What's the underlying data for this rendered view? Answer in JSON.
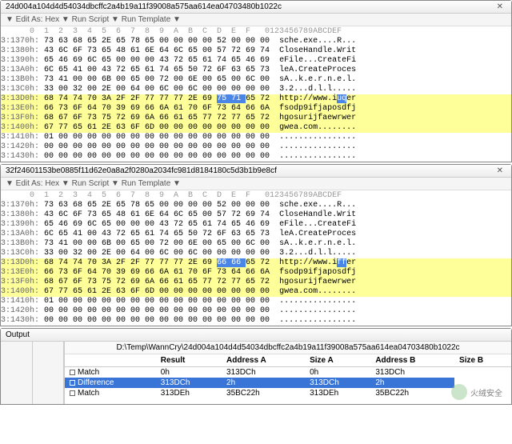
{
  "panel1": {
    "title": "24d004a104d4d54034dbcffc2a4b19a11f39008a575aa614ea04703480b1022c",
    "toolbar": "▼ Edit As: Hex ▼  Run Script ▼  Run Template ▼",
    "header": "      0  1  2  3  4  5  6  7  8  9  A  B  C  D  E  F   0123456789ABCDEF",
    "rows": [
      {
        "addr": "3:1370h:",
        "hex": " 73 63 68 65 2E 65 78 65 00 00 00 00 52 00 00 00 ",
        "ascii": " sche.exe....R..."
      },
      {
        "addr": "3:1380h:",
        "hex": " 43 6C 6F 73 65 48 61 6E 64 6C 65 00 57 72 69 74 ",
        "ascii": " CloseHandle.Writ"
      },
      {
        "addr": "3:1390h:",
        "hex": " 65 46 69 6C 65 00 00 00 43 72 65 61 74 65 46 69 ",
        "ascii": " eFile...CreateFi"
      },
      {
        "addr": "3:13A0h:",
        "hex": " 6C 65 41 00 43 72 65 61 74 65 50 72 6F 63 65 73 ",
        "ascii": " leA.CreateProces"
      },
      {
        "addr": "3:13B0h:",
        "hex": " 73 41 00 00 6B 00 65 00 72 00 6E 00 65 00 6C 00 ",
        "ascii": " sA..k.e.r.n.e.l."
      },
      {
        "addr": "3:13C0h:",
        "hex": " 33 00 32 00 2E 00 64 00 6C 00 6C 00 00 00 00 00 ",
        "ascii": " 3.2...d.l.l....."
      },
      {
        "addr": "3:13D0h:",
        "hex": " 68 74 74 70 3A 2F 2F 77 77 77 2E 69 ",
        "ascii": " http://www.i",
        "hl": true,
        "blue_hex": "75 71 ",
        "blue_ascii": "uq",
        "tail_hex": "65 72 ",
        "tail_ascii": "er"
      },
      {
        "addr": "3:13E0h:",
        "hex": " 66 73 6F 64 70 39 69 66 6A 61 70 6F 73 64 66 6A ",
        "ascii": " fsodp9ifjaposdfj",
        "hl": true
      },
      {
        "addr": "3:13F0h:",
        "hex": " 68 67 6F 73 75 72 69 6A 66 61 65 77 72 77 65 72 ",
        "ascii": " hgosurijfaewrwer",
        "hl": true
      },
      {
        "addr": "3:1400h:",
        "hex": " 67 77 65 61 2E 63 6F 6D 00 00 00 00 00 00 00 00 ",
        "ascii": " gwea.com........",
        "hl": true
      },
      {
        "addr": "3:1410h:",
        "hex": " 01 00 00 00 00 00 00 00 00 00 00 00 00 00 00 00 ",
        "ascii": " ................"
      },
      {
        "addr": "3:1420h:",
        "hex": " 00 00 00 00 00 00 00 00 00 00 00 00 00 00 00 00 ",
        "ascii": " ................"
      },
      {
        "addr": "3:1430h:",
        "hex": " 00 00 00 00 00 00 00 00 00 00 00 00 00 00 00 00 ",
        "ascii": " ................"
      }
    ]
  },
  "panel2": {
    "title": "32f24601153be0885f11d62e0a8a2f0280a2034fc981d8184180c5d3b1b9e8cf",
    "toolbar": "▼ Edit As: Hex ▼  Run Script ▼  Run Template ▼",
    "header": "      0  1  2  3  4  5  6  7  8  9  A  B  C  D  E  F   0123456789ABCDEF",
    "rows": [
      {
        "addr": "3:1370h:",
        "hex": " 73 63 68 65 2E 65 78 65 00 00 00 00 52 00 00 00 ",
        "ascii": " sche.exe....R..."
      },
      {
        "addr": "3:1380h:",
        "hex": " 43 6C 6F 73 65 48 61 6E 64 6C 65 00 57 72 69 74 ",
        "ascii": " CloseHandle.Writ"
      },
      {
        "addr": "3:1390h:",
        "hex": " 65 46 69 6C 65 00 00 00 43 72 65 61 74 65 46 69 ",
        "ascii": " eFile...CreateFi"
      },
      {
        "addr": "3:13A0h:",
        "hex": " 6C 65 41 00 43 72 65 61 74 65 50 72 6F 63 65 73 ",
        "ascii": " leA.CreateProces"
      },
      {
        "addr": "3:13B0h:",
        "hex": " 73 41 00 00 6B 00 65 00 72 00 6E 00 65 00 6C 00 ",
        "ascii": " sA..k.e.r.n.e.l."
      },
      {
        "addr": "3:13C0h:",
        "hex": " 33 00 32 00 2E 00 64 00 6C 00 6C 00 00 00 00 00 ",
        "ascii": " 3.2...d.l.l....."
      },
      {
        "addr": "3:13D0h:",
        "hex": " 68 74 74 70 3A 2F 2F 77 77 77 2E 69 ",
        "ascii": " http://www.i",
        "hl": true,
        "blue_hex": "66 66 ",
        "blue_ascii": "ff",
        "tail_hex": "65 72 ",
        "tail_ascii": "er"
      },
      {
        "addr": "3:13E0h:",
        "hex": " 66 73 6F 64 70 39 69 66 6A 61 70 6F 73 64 66 6A ",
        "ascii": " fsodp9ifjaposdfj",
        "hl": true
      },
      {
        "addr": "3:13F0h:",
        "hex": " 68 67 6F 73 75 72 69 6A 66 61 65 77 72 77 65 72 ",
        "ascii": " hgosurijfaewrwer",
        "hl": true
      },
      {
        "addr": "3:1400h:",
        "hex": " 67 77 65 61 2E 63 6F 6D 00 00 00 00 00 00 00 00 ",
        "ascii": " gwea.com........",
        "hl": true
      },
      {
        "addr": "3:1410h:",
        "hex": " 01 00 00 00 00 00 00 00 00 00 00 00 00 00 00 00 ",
        "ascii": " ................"
      },
      {
        "addr": "3:1420h:",
        "hex": " 00 00 00 00 00 00 00 00 00 00 00 00 00 00 00 00 ",
        "ascii": " ................"
      },
      {
        "addr": "3:1430h:",
        "hex": " 00 00 00 00 00 00 00 00 00 00 00 00 00 00 00 00 ",
        "ascii": " ................"
      }
    ]
  },
  "output": {
    "title": "Output",
    "path": "D:\\Temp\\WannCry\\24d004a104d4d54034dbcffc2a4b19a11f39008a575aa614ea04703480b1022c",
    "headers": [
      "Result",
      "Address A",
      "Size A",
      "Address B",
      "Size B"
    ],
    "rows": [
      {
        "sel": false,
        "r": "Match",
        "aa": "0h",
        "sa": "313DCh",
        "ab": "0h",
        "sb": "313DCh"
      },
      {
        "sel": true,
        "r": "Difference",
        "aa": "313DCh",
        "sa": "2h",
        "ab": "313DCh",
        "sb": "2h"
      },
      {
        "sel": false,
        "r": "Match",
        "aa": "313DEh",
        "sa": "35BC22h",
        "ab": "313DEh",
        "sb": "35BC22h"
      }
    ]
  },
  "watermark": "火绒安全"
}
